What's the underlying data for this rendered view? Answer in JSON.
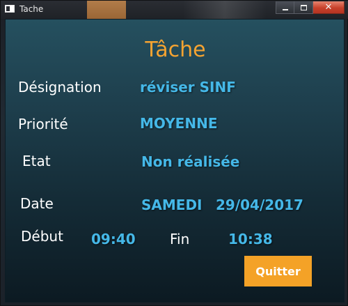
{
  "window": {
    "title": "Tache",
    "controls": {
      "minimize": "minimize",
      "maximize": "maximize",
      "close": "✕"
    }
  },
  "task": {
    "heading": "Tâche",
    "designation_label": "Désignation",
    "designation_value": "réviser SINF",
    "priorite_label": "Priorité",
    "priorite_value": "MOYENNE",
    "etat_label": "Etat",
    "etat_value": "Non réalisée",
    "date_label": "Date",
    "date_day": "SAMEDI",
    "date_value": "29/04/2017",
    "debut_label": "Début",
    "debut_value": "09:40",
    "fin_label": "Fin",
    "fin_value": "10:38"
  },
  "actions": {
    "quit_label": "Quitter"
  },
  "colors": {
    "heading": "#f5a331",
    "value": "#45b8e8",
    "button": "#f4a227",
    "close_button": "#c7412b"
  }
}
